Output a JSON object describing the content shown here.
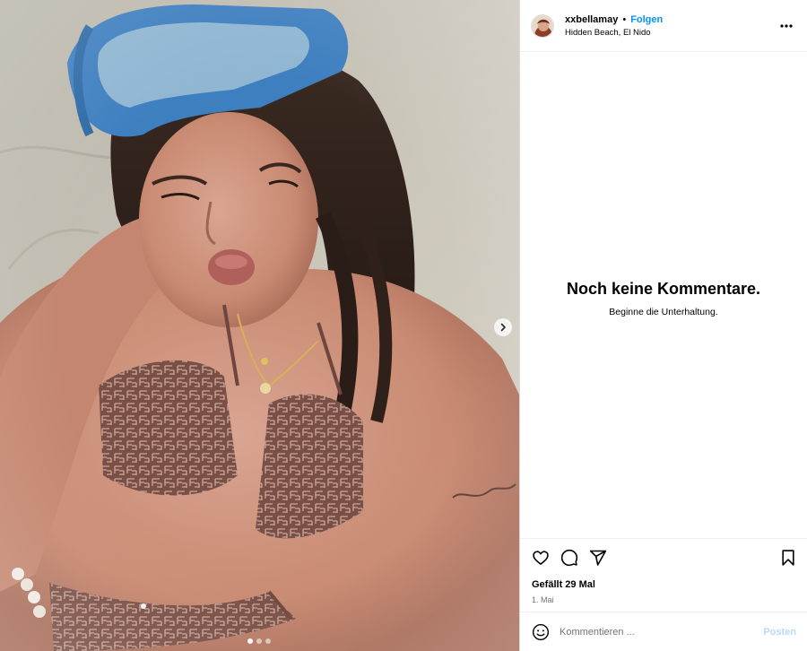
{
  "post": {
    "username": "xxbellamay",
    "separator": "•",
    "follow_label": "Folgen",
    "location": "Hidden Beach, El Nido",
    "more_icon": "more-horizontal-icon"
  },
  "media": {
    "next_icon": "chevron-right-icon",
    "carousel_count": 3,
    "carousel_active": 1
  },
  "comments": {
    "empty_title": "Noch keine Kommentare.",
    "empty_subtitle": "Beginne die Unterhaltung."
  },
  "actions": {
    "like_icon": "heart-icon",
    "comment_icon": "comment-icon",
    "share_icon": "paper-plane-icon",
    "save_icon": "bookmark-icon"
  },
  "stats": {
    "likes_text": "Gefällt 29 Mal",
    "date_text": "1. Mai"
  },
  "composer": {
    "emoji_icon": "smiley-icon",
    "placeholder": "Kommentieren ...",
    "post_label": "Posten"
  },
  "colors": {
    "link_blue": "#0095f6",
    "post_disabled": "#b3dbff",
    "muted": "#737373"
  }
}
